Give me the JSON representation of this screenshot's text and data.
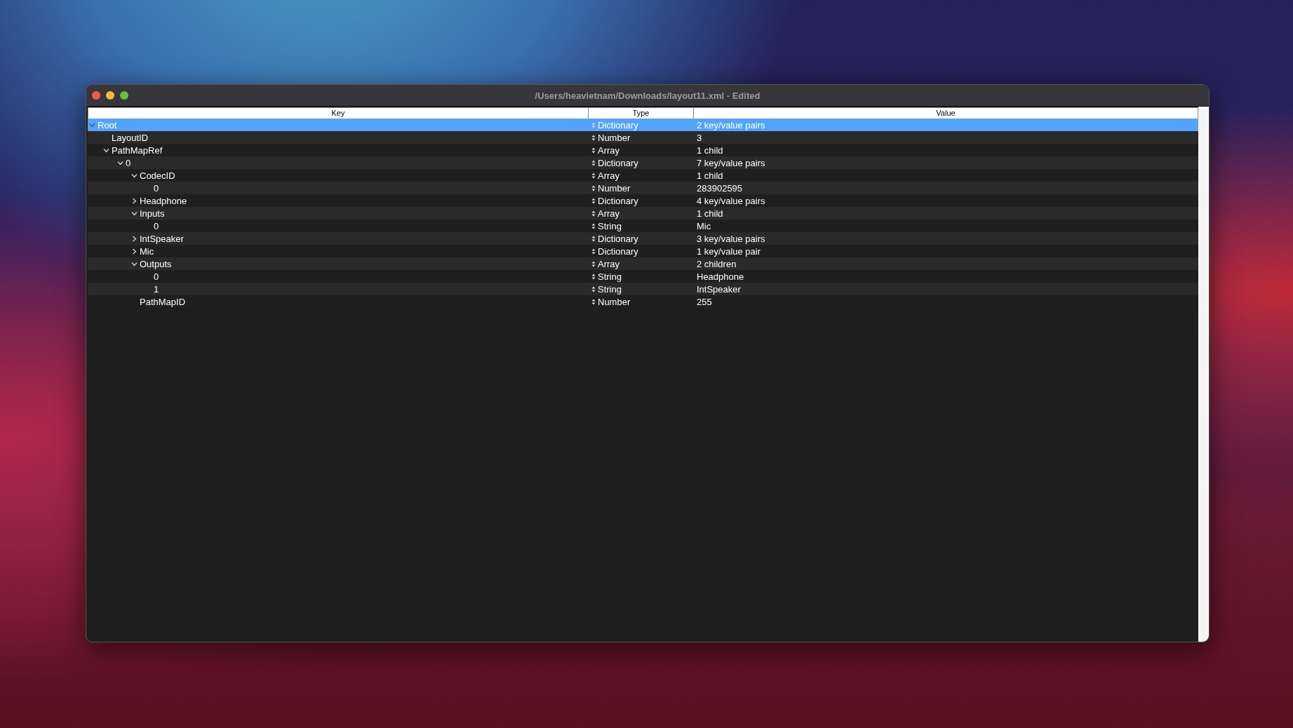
{
  "window": {
    "title": "/Users/heavietnam/Downloads/layout11.xml - Edited"
  },
  "table": {
    "columns": [
      "Key",
      "Type",
      "Value"
    ],
    "rows": [
      {
        "key": "Root",
        "type": "Dictionary",
        "value": "2 key/value pairs",
        "selected": true,
        "expanded": true,
        "children": [
          {
            "key": "LayoutID",
            "type": "Number",
            "value": "3",
            "selected": false
          },
          {
            "key": "PathMapRef",
            "type": "Array",
            "value": "1 child",
            "selected": false,
            "expanded": true,
            "children": [
              {
                "key": "0",
                "type": "Dictionary",
                "value": "7 key/value pairs",
                "selected": false,
                "expanded": true,
                "children": [
                  {
                    "key": "CodecID",
                    "type": "Array",
                    "value": "1 child",
                    "selected": false,
                    "expanded": true,
                    "children": [
                      {
                        "key": "0",
                        "type": "Number",
                        "value": "283902595",
                        "selected": false
                      }
                    ]
                  },
                  {
                    "key": "Headphone",
                    "type": "Dictionary",
                    "value": "4 key/value pairs",
                    "selected": false,
                    "expanded": false
                  },
                  {
                    "key": "Inputs",
                    "type": "Array",
                    "value": "1 child",
                    "selected": false,
                    "expanded": true,
                    "children": [
                      {
                        "key": "0",
                        "type": "String",
                        "value": "Mic",
                        "selected": false
                      }
                    ]
                  },
                  {
                    "key": "IntSpeaker",
                    "type": "Dictionary",
                    "value": "3 key/value pairs",
                    "selected": false,
                    "expanded": false
                  },
                  {
                    "key": "Mic",
                    "type": "Dictionary",
                    "value": "1 key/value pair",
                    "selected": false,
                    "expanded": false
                  },
                  {
                    "key": "Outputs",
                    "type": "Array",
                    "value": "2 children",
                    "selected": false,
                    "expanded": true,
                    "children": [
                      {
                        "key": "0",
                        "type": "String",
                        "value": "Headphone",
                        "selected": false
                      },
                      {
                        "key": "1",
                        "type": "String",
                        "value": "IntSpeaker",
                        "selected": false
                      }
                    ]
                  },
                  {
                    "key": "PathMapID",
                    "type": "Number",
                    "value": "255",
                    "selected": false
                  }
                ]
              }
            ]
          }
        ]
      }
    ]
  }
}
